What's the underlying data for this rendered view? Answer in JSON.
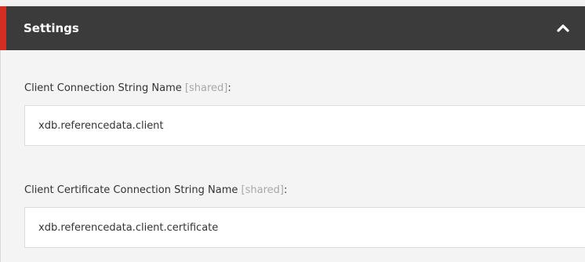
{
  "settings_panel": {
    "title": "Settings",
    "collapse_icon": "chevron-up-icon",
    "accent_color": "#d42e22",
    "header_color": "#3b3b3b",
    "fields": [
      {
        "label": "Client Connection String Name",
        "scope": "[shared]",
        "suffix": ":",
        "value": "xdb.referencedata.client"
      },
      {
        "label": "Client Certificate Connection String Name",
        "scope": "[shared]",
        "suffix": ":",
        "value": "xdb.referencedata.client.certificate"
      }
    ]
  }
}
